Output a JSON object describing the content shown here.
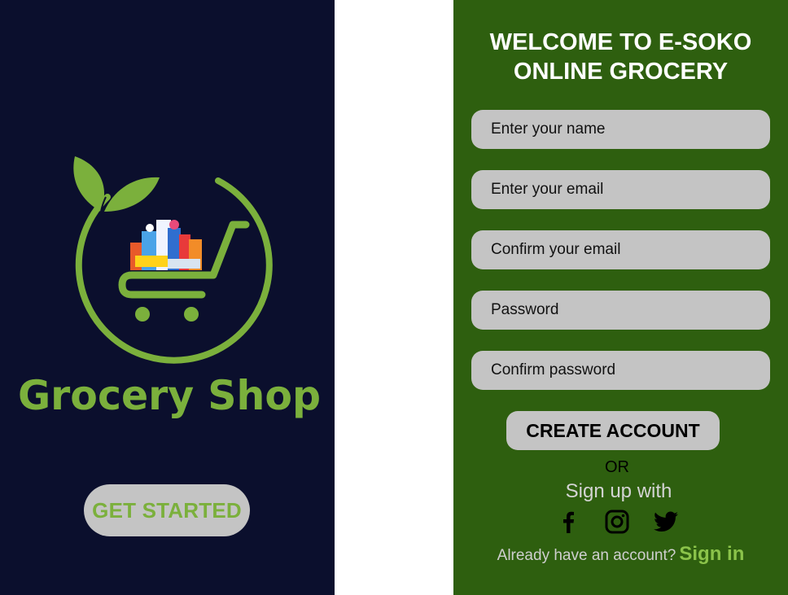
{
  "splash": {
    "logo_text": "Grocery Shop",
    "get_started_label": "GET STARTED",
    "background_color": "#0b0f2d",
    "brand_green": "#7bb03c"
  },
  "signup": {
    "background_color": "#2e5f0f",
    "title_line1": "WELCOME TO E-SOKO",
    "title_line2": "ONLINE GROCERY",
    "fields": [
      {
        "placeholder": "Enter your name"
      },
      {
        "placeholder": "Enter your email"
      },
      {
        "placeholder": "Confirm your email"
      },
      {
        "placeholder": "Password"
      },
      {
        "placeholder": "Confirm password"
      }
    ],
    "create_account_label": "CREATE ACCOUNT",
    "or_label": "OR",
    "sign_up_with_label": "Sign up with",
    "social_icons": [
      "facebook-icon",
      "instagram-icon",
      "twitter-icon"
    ],
    "already_have_account_text": "Already have an account?",
    "sign_in_label": "Sign in"
  }
}
